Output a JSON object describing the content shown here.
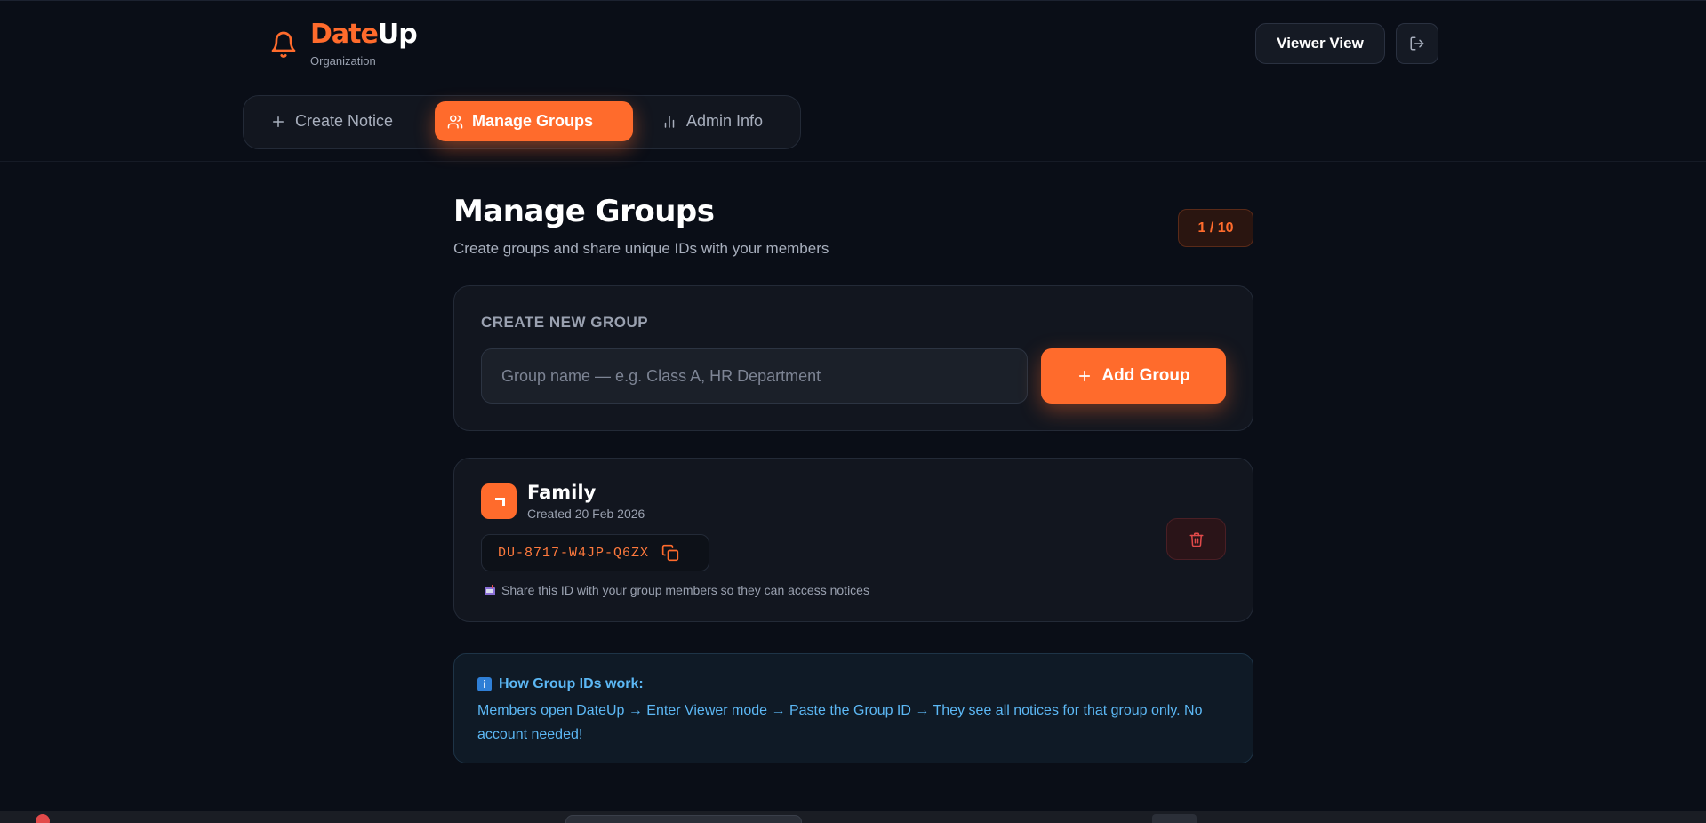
{
  "header": {
    "logo_part1": "Date",
    "logo_part2": "Up",
    "subtitle": "Organization",
    "viewer_button": "Viewer View"
  },
  "tabs": [
    {
      "label": "Create Notice",
      "icon": "plus-icon",
      "active": false
    },
    {
      "label": "Manage Groups",
      "icon": "users-icon",
      "active": true
    },
    {
      "label": "Admin Info",
      "icon": "bar-chart-icon",
      "active": false
    }
  ],
  "page": {
    "title": "Manage Groups",
    "subtitle": "Create groups and share unique IDs with your members",
    "group_count": "1 / 10"
  },
  "create_group": {
    "label": "CREATE NEW GROUP",
    "input_placeholder": "Group name — e.g. Class A, HR Department",
    "input_value": "",
    "add_button": "Add Group"
  },
  "groups": [
    {
      "name": "Family",
      "created": "Created 20 Feb 2026",
      "id": "DU-8717-W4JP-Q6ZX",
      "share_hint": "Share this ID with your group members so they can access notices"
    }
  ],
  "info": {
    "title": "How Group IDs work:",
    "text": "Members open DateUp → Enter Viewer mode → Paste the Group ID → They see all notices for that group only. No account needed!"
  },
  "colors": {
    "accent": "#ff6b2c",
    "background": "#0a0e17",
    "card": "#12161f",
    "info": "#5cb8f5",
    "danger": "#e24a4a"
  }
}
